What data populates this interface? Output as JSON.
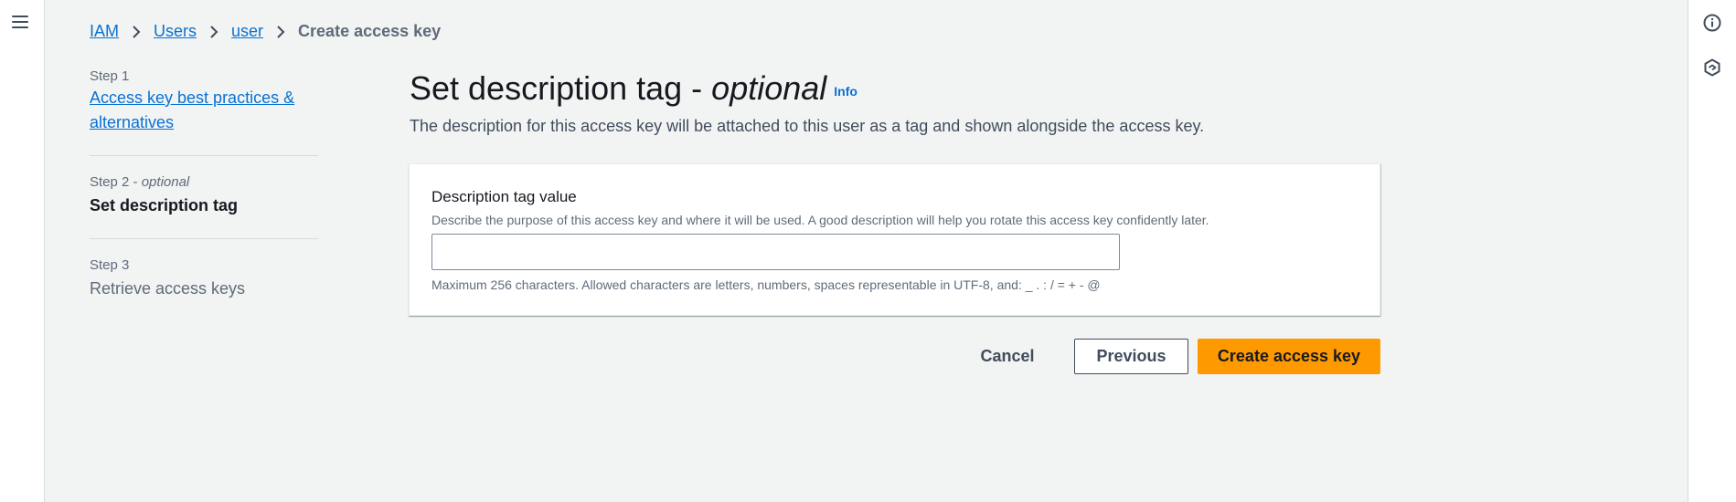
{
  "breadcrumb": [
    {
      "label": "IAM",
      "type": "link"
    },
    {
      "label": "Users",
      "type": "link"
    },
    {
      "label": "user",
      "type": "link"
    },
    {
      "label": "Create access key",
      "type": "current"
    }
  ],
  "steps": [
    {
      "label": "Step 1",
      "title": "Access key best practices &",
      "title2": "alternatives",
      "state": "link"
    },
    {
      "label": "Step 2",
      "label_suffix": "optional",
      "title": "Set description tag",
      "state": "current"
    },
    {
      "label": "Step 3",
      "title": "Retrieve access keys",
      "state": "disabled"
    }
  ],
  "page": {
    "title": "Set description tag - ",
    "title_optional": "optional",
    "info": "Info",
    "description": "The description for this access key will be attached to this user as a tag and shown alongside the access key."
  },
  "form": {
    "label": "Description tag value",
    "description": "Describe the purpose of this access key and where it will be used. A good description will help you rotate this access key confidently later.",
    "value": "",
    "constraint": "Maximum 256 characters. Allowed characters are letters, numbers, spaces representable in UTF-8, and: _ . : / = + - @"
  },
  "actions": {
    "cancel": "Cancel",
    "previous": "Previous",
    "create": "Create access key"
  },
  "icons": {
    "menu": "hamburger-menu-icon",
    "info": "info-circle-icon",
    "feedback": "feedback-icon"
  },
  "colors": {
    "link": "#0972d3",
    "primary_button": "#ff9900",
    "background": "#f2f3f3"
  }
}
